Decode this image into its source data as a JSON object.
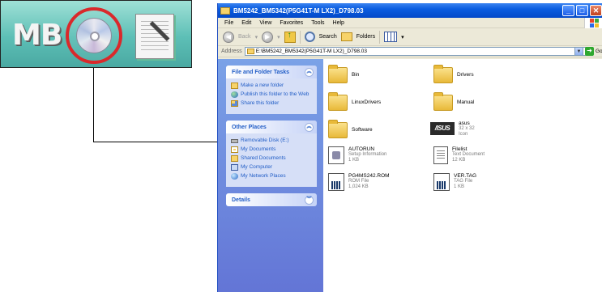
{
  "launcher": {
    "mb_label": "MB"
  },
  "window": {
    "title": "BM5242_BM5342(P5G41T-M LX2)_D798.03",
    "menu": [
      "File",
      "Edit",
      "View",
      "Favorites",
      "Tools",
      "Help"
    ],
    "toolbar": {
      "back_label": "Back",
      "search_label": "Search",
      "folders_label": "Folders"
    },
    "address": {
      "label": "Address",
      "value": "E:\\BM5242_BM5342(P5G41T-M LX2)_D798.03",
      "go_label": "Go"
    }
  },
  "taskpane": {
    "file_tasks": {
      "title": "File and Folder Tasks",
      "items": [
        "Make a new folder",
        "Publish this folder to the Web",
        "Share this folder"
      ]
    },
    "other_places": {
      "title": "Other Places",
      "items": [
        "Removable Disk (E:)",
        "My Documents",
        "Shared Documents",
        "My Computer",
        "My Network Places"
      ]
    },
    "details": {
      "title": "Details"
    }
  },
  "files": [
    {
      "name": "Bin"
    },
    {
      "name": "Drivers"
    },
    {
      "name": "LinuxDrivers"
    },
    {
      "name": "Manual"
    },
    {
      "name": "Software"
    },
    {
      "name": "asus",
      "line1": "32 x 32",
      "line2": "Icon"
    },
    {
      "name": "AUTORUN",
      "line1": "Setup Information",
      "line2": "1 KB"
    },
    {
      "name": "Filelist",
      "line1": "Text Document",
      "line2": "12 KB"
    },
    {
      "name": "PG4MS242.ROM",
      "line1": "ROM File",
      "line2": "1,024 KB"
    },
    {
      "name": "VER.TAG",
      "line1": "TAG File",
      "line2": "1 KB"
    }
  ],
  "asus_logo_text": "/ISUS",
  "colors": {
    "titlebar": "#0a5de0",
    "taskpane": "#6375d6",
    "cd_ring": "#d9292b",
    "launcher": "#5dbfb6"
  }
}
